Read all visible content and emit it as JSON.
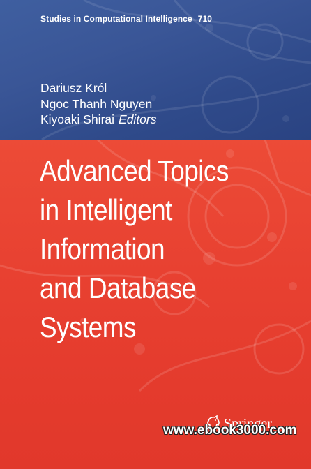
{
  "series": {
    "name": "Studies in Computational Intelligence",
    "number": "710"
  },
  "editors": {
    "names": [
      "Dariusz Król",
      "Ngoc Thanh Nguyen",
      "Kiyoaki Shirai"
    ],
    "role": "Editors"
  },
  "title": {
    "lines": [
      "Advanced Topics",
      "in Intelligent",
      "Information",
      "and Database",
      "Systems"
    ]
  },
  "publisher": {
    "name": "Springer",
    "logo_icon": "springer-horse-icon"
  },
  "watermark": {
    "text": "www.ebook3000.com"
  },
  "colors": {
    "top_band": "#3a5697",
    "bottom_band": "#e84131",
    "text": "#ffffff"
  }
}
